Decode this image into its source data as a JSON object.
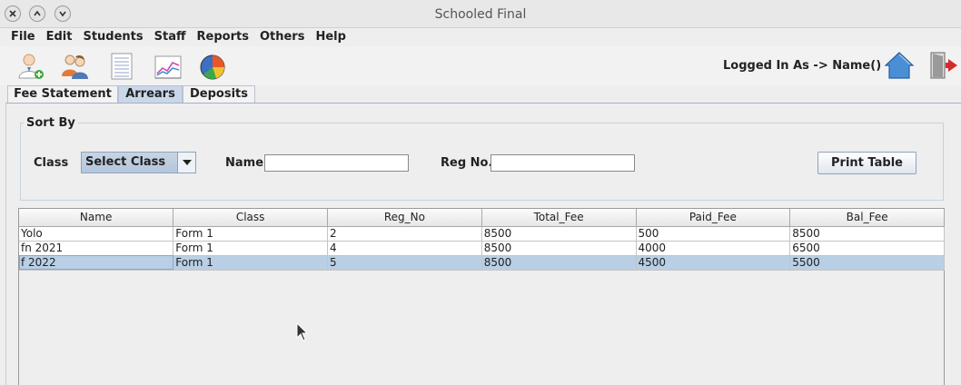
{
  "window": {
    "title": "Schooled Final"
  },
  "menu": [
    "File",
    "Edit",
    "Students",
    "Staff",
    "Reports",
    "Others",
    "Help"
  ],
  "toolbar": {
    "icons": [
      "add-student-icon",
      "users-icon",
      "document-icon",
      "chart-icon",
      "pie-chart-icon"
    ],
    "logged_in": "Logged In As -> Name()",
    "right_icons": [
      "home-icon",
      "logout-icon"
    ]
  },
  "tabs": [
    "Fee Statement",
    "Arrears",
    "Deposits"
  ],
  "active_tab": "Arrears",
  "sort": {
    "title": "Sort By",
    "class_label": "Class",
    "class_select": "Select Class",
    "name_label": "Name",
    "name_value": "",
    "regno_label": "Reg No.",
    "regno_value": "",
    "print_button": "Print Table"
  },
  "table": {
    "columns": [
      "Name",
      "Class",
      "Reg_No",
      "Total_Fee",
      "Paid_Fee",
      "Bal_Fee"
    ],
    "rows": [
      [
        "Yolo",
        "Form 1",
        "2",
        "8500",
        "500",
        "8500"
      ],
      [
        "fn 2021",
        "Form 1",
        "4",
        "8500",
        "4000",
        "6500"
      ],
      [
        "f 2022",
        "Form 1",
        "5",
        "8500",
        "4500",
        "5500"
      ]
    ],
    "selected_row": 2
  }
}
